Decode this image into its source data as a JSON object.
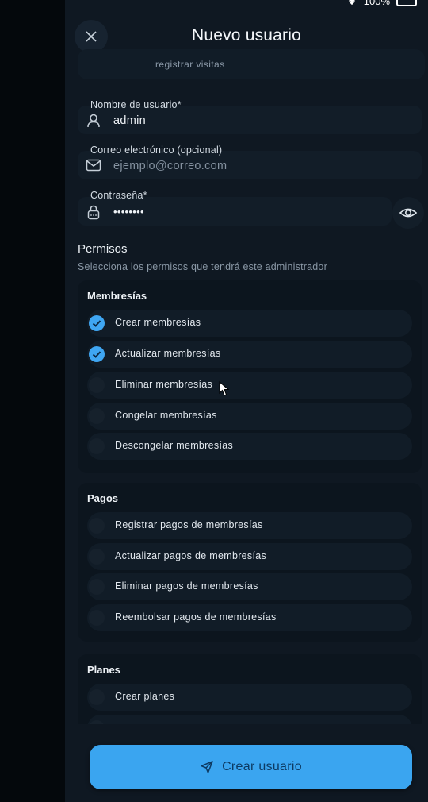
{
  "status": {
    "battery": "100%"
  },
  "header": {
    "title": "Nuevo usuario"
  },
  "cut_text": "registrar visitas",
  "fields": {
    "username": {
      "label": "Nombre de usuario*",
      "value": "admin"
    },
    "email": {
      "label": "Correo electrónico (opcional)",
      "placeholder": "ejemplo@correo.com"
    },
    "password": {
      "label": "Contraseña*",
      "value": "••••••••"
    }
  },
  "permissions": {
    "title": "Permisos",
    "subtitle": "Selecciona los permisos que tendrá este administrador",
    "groups": [
      {
        "title": "Membresías",
        "items": [
          {
            "label": "Crear membresías",
            "checked": true
          },
          {
            "label": "Actualizar membresías",
            "checked": true
          },
          {
            "label": "Eliminar membresías",
            "checked": false
          },
          {
            "label": "Congelar membresías",
            "checked": false
          },
          {
            "label": "Descongelar membresías",
            "checked": false
          }
        ]
      },
      {
        "title": "Pagos",
        "items": [
          {
            "label": "Registrar pagos de membresías",
            "checked": false
          },
          {
            "label": "Actualizar pagos de membresías",
            "checked": false
          },
          {
            "label": "Eliminar pagos de membresías",
            "checked": false
          },
          {
            "label": "Reembolsar pagos de membresías",
            "checked": false
          }
        ]
      },
      {
        "title": "Planes",
        "items": [
          {
            "label": "Crear planes",
            "checked": false
          }
        ]
      }
    ]
  },
  "submit": {
    "label": "Crear usuario"
  },
  "colors": {
    "accent": "#3aa5f0",
    "background": "#0f1822"
  }
}
